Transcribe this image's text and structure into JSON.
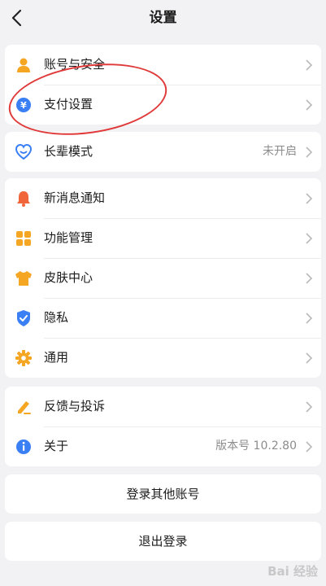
{
  "header": {
    "title": "设置"
  },
  "groups": [
    {
      "items": [
        {
          "label": "账号与安全"
        },
        {
          "label": "支付设置"
        }
      ]
    },
    {
      "items": [
        {
          "label": "长辈模式",
          "value": "未开启"
        }
      ]
    },
    {
      "items": [
        {
          "label": "新消息通知"
        },
        {
          "label": "功能管理"
        },
        {
          "label": "皮肤中心"
        },
        {
          "label": "隐私"
        },
        {
          "label": "通用"
        }
      ]
    },
    {
      "items": [
        {
          "label": "反馈与投诉"
        },
        {
          "label": "关于",
          "value": "版本号 10.2.80"
        }
      ]
    }
  ],
  "buttons": {
    "login_other": "登录其他账号",
    "logout": "退出登录"
  },
  "icons": {
    "account": "person-icon",
    "payment": "yen-coin-icon",
    "elder": "heart-hands-icon",
    "notify": "bell-icon",
    "features": "grid-icon",
    "skin": "tshirt-icon",
    "privacy": "shield-check-icon",
    "general": "gear-icon",
    "feedback": "pen-icon",
    "about": "info-icon"
  },
  "colors": {
    "accent_orange": "#f5a623",
    "accent_blue": "#3b7ff5",
    "annotation_red": "#e03a3a"
  },
  "watermark": "Bai 经验"
}
